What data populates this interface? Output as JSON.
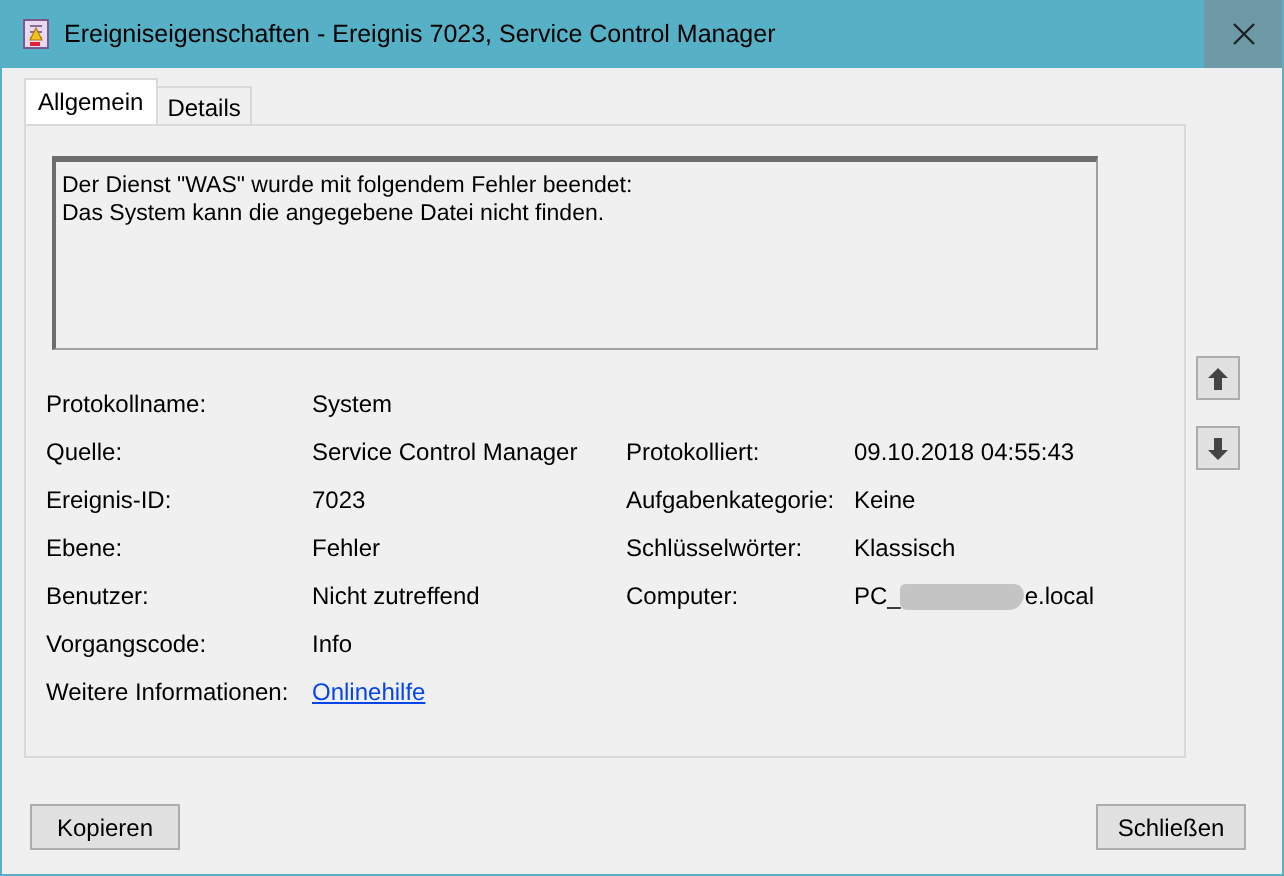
{
  "window": {
    "title": "Ereigniseigenschaften - Ereignis 7023, Service Control Manager"
  },
  "tabs": [
    {
      "label": "Allgemein",
      "selected": true
    },
    {
      "label": "Details",
      "selected": false
    }
  ],
  "message": [
    "Der Dienst \"WAS\" wurde mit folgendem Fehler beendet:",
    "Das System kann die angegebene Datei nicht finden."
  ],
  "rows": [
    {
      "left": {
        "label": "Protokollname:",
        "value": "System",
        "kind": "text"
      }
    },
    {
      "left": {
        "label": "Quelle:",
        "value": "Service Control Manager",
        "kind": "text"
      },
      "right": {
        "label": "Protokolliert:",
        "value": "09.10.2018 04:55:43",
        "kind": "text"
      }
    },
    {
      "left": {
        "label": "Ereignis-ID:",
        "value": "7023",
        "kind": "text"
      },
      "right": {
        "label": "Aufgabenkategorie:",
        "value": "Keine",
        "kind": "text"
      }
    },
    {
      "left": {
        "label": "Ebene:",
        "value": "Fehler",
        "kind": "text"
      },
      "right": {
        "label": "Schlüsselwörter:",
        "value": "Klassisch",
        "kind": "text"
      }
    },
    {
      "left": {
        "label": "Benutzer:",
        "value": "Nicht zutreffend",
        "kind": "text"
      },
      "right": {
        "label": "Computer:",
        "value": "PC_",
        "value_end": "e.local",
        "kind": "redacted"
      }
    },
    {
      "left": {
        "label": "Vorgangscode:",
        "value": "Info",
        "kind": "text"
      }
    },
    {
      "left": {
        "label": "Weitere Informationen:",
        "value": "Onlinehilfe",
        "kind": "link"
      }
    }
  ],
  "buttons": [
    {
      "label": "Kopieren"
    },
    {
      "label": "Schließen"
    }
  ]
}
